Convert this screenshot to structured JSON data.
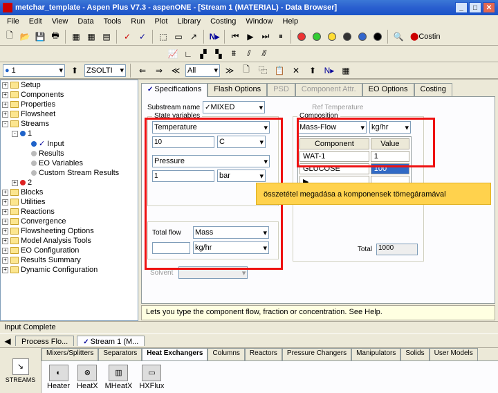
{
  "titlebar": {
    "text": "metchar_template - Aspen Plus V7.3 - aspenONE - [Stream 1 (MATERIAL) - Data Browser]"
  },
  "menubar": [
    "File",
    "Edit",
    "View",
    "Data",
    "Tools",
    "Run",
    "Plot",
    "Library",
    "Costing",
    "Window",
    "Help"
  ],
  "toolbar1_icons": [
    "new",
    "open",
    "save",
    "print",
    "sep",
    "cut",
    "copy",
    "paste",
    "sep",
    "undo",
    "redo",
    "sep",
    "record",
    "next",
    "sep",
    "grid1",
    "grid2",
    "grid3",
    "sep",
    "N-arrow",
    "sep",
    "play-start",
    "play",
    "pause",
    "stop",
    "sep",
    "dot-red",
    "dot-green",
    "dot-yellow",
    "dot-filled",
    "dot-blue",
    "dot-black",
    "sep",
    "find",
    "costing-label"
  ],
  "costing_label": "Costin",
  "browser_toolbar": {
    "current_path": "1",
    "dropdown_label": "ZSOLTI",
    "navset": "All"
  },
  "tree": [
    {
      "exp": "+",
      "label": "Setup",
      "indent": 0
    },
    {
      "exp": "+",
      "label": "Components",
      "indent": 0
    },
    {
      "exp": "+",
      "label": "Properties",
      "indent": 0
    },
    {
      "exp": "+",
      "label": "Flowsheet",
      "indent": 0
    },
    {
      "exp": "-",
      "label": "Streams",
      "indent": 0
    },
    {
      "exp": "-",
      "label": "1",
      "indent": 1,
      "bullet": "#1f63c9"
    },
    {
      "exp": "",
      "label": "Input",
      "indent": 2,
      "bullet": "#1f63c9",
      "check": true
    },
    {
      "exp": "",
      "label": "Results",
      "indent": 2,
      "bullet": "#bbb"
    },
    {
      "exp": "",
      "label": "EO Variables",
      "indent": 2,
      "bullet": "#bbb"
    },
    {
      "exp": "",
      "label": "Custom Stream Results",
      "indent": 2,
      "bullet": "#bbb"
    },
    {
      "exp": "+",
      "label": "2",
      "indent": 1,
      "bullet": "#d22"
    },
    {
      "exp": "+",
      "label": "Blocks",
      "indent": 0
    },
    {
      "exp": "+",
      "label": "Utilities",
      "indent": 0
    },
    {
      "exp": "+",
      "label": "Reactions",
      "indent": 0
    },
    {
      "exp": "+",
      "label": "Convergence",
      "indent": 0
    },
    {
      "exp": "+",
      "label": "Flowsheeting Options",
      "indent": 0
    },
    {
      "exp": "+",
      "label": "Model Analysis Tools",
      "indent": 0
    },
    {
      "exp": "+",
      "label": "EO Configuration",
      "indent": 0
    },
    {
      "exp": "+",
      "label": "Results Summary",
      "indent": 0
    },
    {
      "exp": "+",
      "label": "Dynamic Configuration",
      "indent": 0
    }
  ],
  "tabs": [
    "Specifications",
    "Flash Options",
    "PSD",
    "Component Attr.",
    "EO Options",
    "Costing"
  ],
  "form": {
    "substream_label": "Substream name",
    "substream_value": "MIXED",
    "ref_temp_label": "Ref Temperature",
    "state_group": "State variables",
    "temperature_label": "Temperature",
    "temperature_value": "10",
    "temperature_unit": "C",
    "pressure_label": "Pressure",
    "pressure_value": "1",
    "pressure_unit": "bar",
    "comp_group": "Composition",
    "comp_basis": "Mass-Flow",
    "comp_unit": "kg/hr",
    "comp_col1": "Component",
    "comp_col2": "Value",
    "comp_rows": [
      {
        "name": "WAT-1",
        "value": "1"
      },
      {
        "name": "GLUCOSE",
        "value": "100"
      }
    ],
    "totalflow_label": "Total flow",
    "totalflow_basis": "Mass",
    "totalflow_value": "",
    "totalflow_unit": "kg/hr",
    "solvent_label": "Solvent",
    "total_label": "Total",
    "total_value": "1000"
  },
  "annotation": "összetétel megadása a komponensek tömegáramával",
  "help_text": "Lets you type the component flow, fraction or concentration. See Help.",
  "status_text": "Input Complete",
  "bottom_tabs": [
    "Process Flo...",
    "Stream 1 (M..."
  ],
  "palette": {
    "streams_label": "STREAMS",
    "categories": [
      "Mixers/Splitters",
      "Separators",
      "Heat Exchangers",
      "Columns",
      "Reactors",
      "Pressure Changers",
      "Manipulators",
      "Solids",
      "User Models"
    ],
    "active_category_index": 2,
    "items": [
      "Heater",
      "HeatX",
      "MHeatX",
      "HXFlux"
    ]
  }
}
